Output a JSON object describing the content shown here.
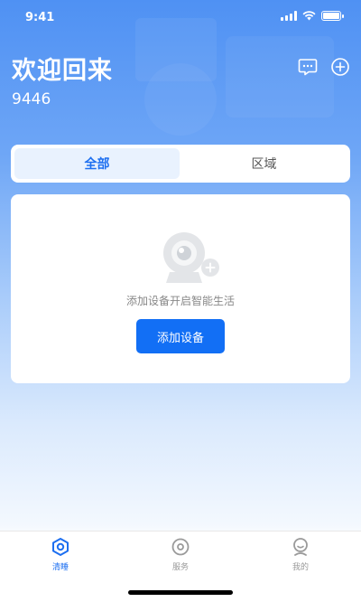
{
  "status_bar": {
    "time": "9:41"
  },
  "header": {
    "welcome": "欢迎回来",
    "user_id": "9446",
    "icons": [
      "message-icon",
      "add-circle-icon"
    ]
  },
  "tabs": [
    {
      "label": "全部",
      "active": true
    },
    {
      "label": "区域",
      "active": false
    }
  ],
  "empty_state": {
    "message": "添加设备开启智能生活",
    "button_label": "添加设备",
    "icon": "camera-add-icon"
  },
  "tabbar": [
    {
      "label": "清睡",
      "icon": "home-icon",
      "active": true
    },
    {
      "label": "服务",
      "icon": "service-icon",
      "active": false
    },
    {
      "label": "我的",
      "icon": "profile-icon",
      "active": false
    }
  ],
  "colors": {
    "primary": "#126ff5",
    "header_bg": "#4f91f3"
  }
}
